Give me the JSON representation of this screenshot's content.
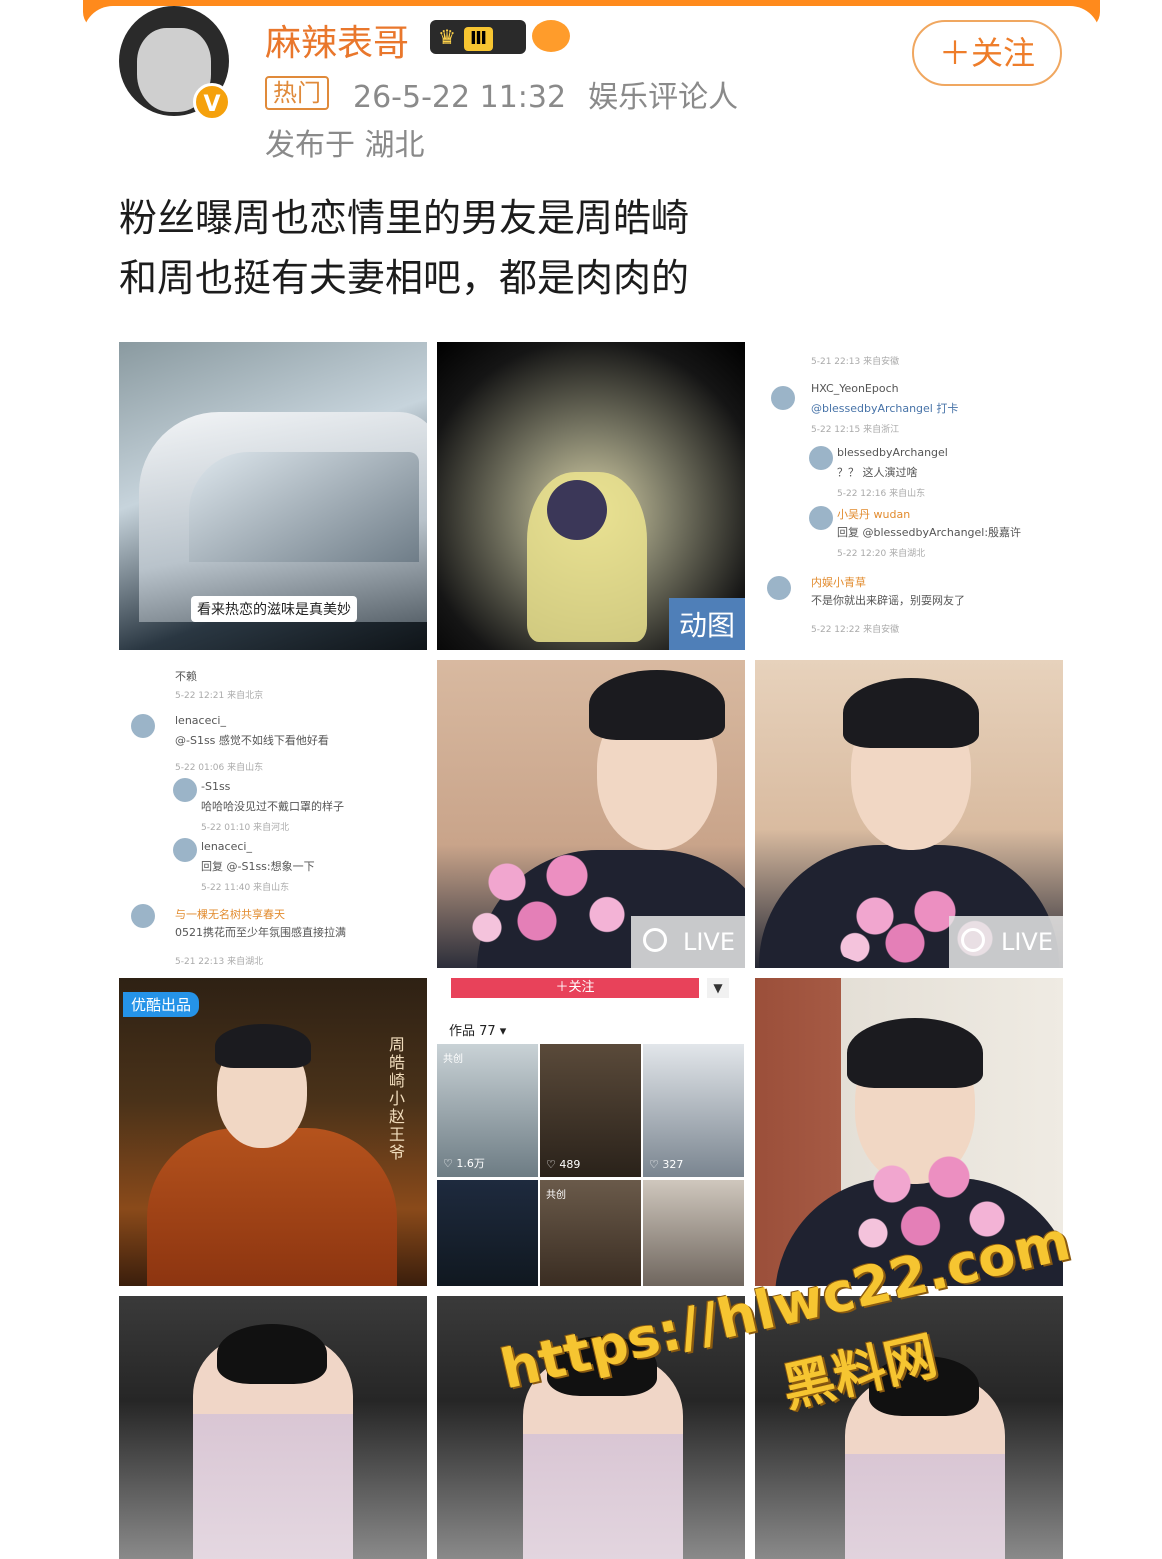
{
  "post": {
    "author": {
      "name": "麻辣表哥",
      "level_badge": "Ⅲ",
      "verified_mark": "V"
    },
    "hot_tag": "热门",
    "timestamp": "26-5-22 11:32",
    "author_title": "娱乐评论人",
    "location": "发布于 湖北",
    "follow_button": "＋关注",
    "text_line1": "粉丝曝周也恋情里的男友是周皓崎",
    "text_line2": "和周也挺有夫妻相吧，都是肉肉的"
  },
  "images": {
    "img1_caption": "看来热恋的滋味是真美妙",
    "img2_badge": "动图",
    "img3_comments": [
      {
        "text": "5-21 22:13 来自安徽",
        "style": "gray"
      },
      {
        "text": "HXC_YeonEpoch",
        "style": "normal"
      },
      {
        "text": "@blessedbyArchangel 打卡",
        "style": "blue"
      },
      {
        "text": "5-22 12:15 来自浙江",
        "style": "gray"
      },
      {
        "text": "blessedbyArchangel",
        "style": "normal"
      },
      {
        "text": "？？ 这人演过啥",
        "style": "normal"
      },
      {
        "text": "5-22 12:16 来自山东",
        "style": "gray"
      },
      {
        "text": "小吴丹 wudan",
        "style": "orange"
      },
      {
        "text": "回复 @blessedbyArchangel:殷嘉许",
        "style": "normal"
      },
      {
        "text": "5-22 12:20 来自湖北",
        "style": "gray"
      },
      {
        "text": "内娱小青草",
        "style": "orange"
      },
      {
        "text": "不是你就出来辟谣，别耍网友了",
        "style": "normal"
      },
      {
        "text": "5-22 12:22 来自安徽",
        "style": "gray"
      }
    ],
    "img4_comments": [
      {
        "text": "不赖",
        "style": "normal"
      },
      {
        "text": "5-22 12:21 来自北京",
        "style": "gray"
      },
      {
        "text": "lenaceci_",
        "style": "normal"
      },
      {
        "text": "@-S1ss 感觉不如线下看他好看",
        "style": "normal"
      },
      {
        "text": "5-22 01:06 来自山东",
        "style": "gray"
      },
      {
        "text": "-S1ss",
        "style": "normal"
      },
      {
        "text": "哈哈哈没见过不戴口罩的样子",
        "style": "normal"
      },
      {
        "text": "5-22 01:10 来自河北",
        "style": "gray"
      },
      {
        "text": "lenaceci_",
        "style": "normal"
      },
      {
        "text": "回复 @-S1ss:想象一下",
        "style": "normal"
      },
      {
        "text": "5-22 11:40 来自山东",
        "style": "gray"
      },
      {
        "text": "与一棵无名树共享春天",
        "style": "orange"
      },
      {
        "text": "0521携花而至少年氛围感直接拉满",
        "style": "normal"
      },
      {
        "text": "5-21 22:13 来自湖北",
        "style": "gray"
      }
    ],
    "live_label": "LIVE",
    "youku_tag": "优酷出品",
    "drama_side_text": "周皓崎小赵王爷",
    "profile_follow": "＋关注",
    "profile_dropdown": "▼",
    "works_label": "作品 77 ▾",
    "thumb_likes": [
      "♡ 1.6万",
      "♡ 489",
      "♡ 327"
    ],
    "thumb_tags": [
      "共创",
      "",
      "",
      "",
      "共创",
      ""
    ]
  },
  "watermark": {
    "url": "https://hlwc22.com",
    "name": "黑料网"
  },
  "colors": {
    "accent_orange": "#e9772c",
    "meta_gray": "#8a8a8a",
    "live_badge": "#4f7fb8"
  }
}
